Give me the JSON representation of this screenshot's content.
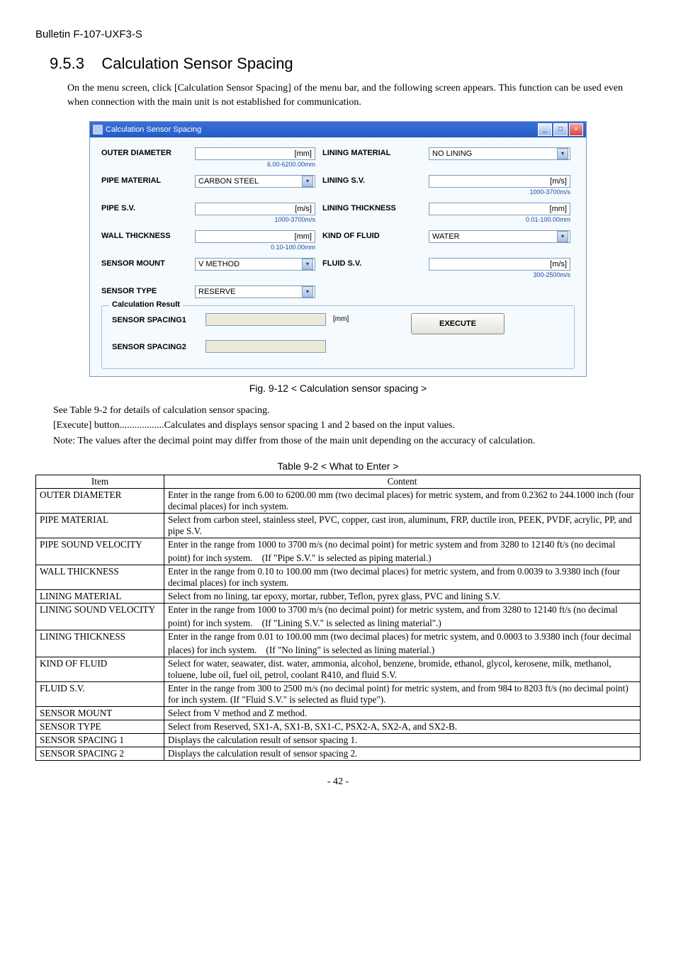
{
  "doc_header": "Bulletin F-107-UXF3-S",
  "section_number": "9.5.3",
  "section_title": "Calculation Sensor Spacing",
  "intro": "On the menu screen, click [Calculation Sensor Spacing] of the menu bar, and the following screen appears. This function can be used even when connection with the main unit is not established for communication.",
  "window": {
    "title": "Calculation Sensor Spacing",
    "rows": [
      {
        "label_l": "OUTER DIAMETER",
        "field_l": {
          "type": "input",
          "unit": "[mm]",
          "range": "6.00-6200.00mm"
        },
        "label_r": "LINING MATERIAL",
        "field_r": {
          "type": "dropdown",
          "value": "NO LINING"
        }
      },
      {
        "label_l": "PIPE MATERIAL",
        "field_l": {
          "type": "dropdown",
          "value": "CARBON STEEL"
        },
        "label_r": "LINING S.V.",
        "field_r": {
          "type": "input",
          "unit": "[m/s]",
          "range": "1000-3700m/s"
        }
      },
      {
        "label_l": "PIPE S.V.",
        "field_l": {
          "type": "input",
          "unit": "[m/s]",
          "range": "1000-3700m/s"
        },
        "label_r": "LINING THICKNESS",
        "field_r": {
          "type": "input",
          "unit": "[mm]",
          "range": "0.01-100.00mm"
        }
      },
      {
        "label_l": "WALL THICKNESS",
        "field_l": {
          "type": "input",
          "unit": "[mm]",
          "range": "0.10-100.00mm"
        },
        "label_r": "KIND OF FLUID",
        "field_r": {
          "type": "dropdown",
          "value": "WATER"
        }
      },
      {
        "label_l": "SENSOR MOUNT",
        "field_l": {
          "type": "dropdown",
          "value": "V METHOD"
        },
        "label_r": "FLUID S.V.",
        "field_r": {
          "type": "input",
          "unit": "[m/s]",
          "range": "300-2500m/s"
        }
      },
      {
        "label_l": "SENSOR TYPE",
        "field_l": {
          "type": "dropdown",
          "value": "RESERVE"
        },
        "label_r": "",
        "field_r": null
      }
    ],
    "result_group_title": "Calculation Result",
    "result1_label": "SENSOR SPACING1",
    "result2_label": "SENSOR SPACING2",
    "result_unit": "[mm]",
    "execute": "EXECUTE"
  },
  "fig_caption": "Fig. 9-12 < Calculation sensor spacing >",
  "see_table": "See Table 9-2 for details of calculation sensor spacing.",
  "execute_line": "[Execute] button..................Calculates and displays sensor spacing 1 and 2 based on the input values.",
  "note_line": "Note: The values after the decimal point may differ from those of the main unit depending on the accuracy of calculation.",
  "table_caption": "Table 9-2 < What to Enter >",
  "table_headers": {
    "item": "Item",
    "content": "Content"
  },
  "table_rows": [
    {
      "item": "OUTER DIAMETER",
      "content": "Enter in the range from 6.00 to 6200.00 mm (two decimal places) for metric system, and from 0.2362 to 244.1000 inch (four decimal places) for inch system."
    },
    {
      "item": "PIPE MATERIAL",
      "content": "Select from carbon steel, stainless steel, PVC, copper, cast iron, aluminum, FRP, ductile iron, PEEK, PVDF, acrylic, PP, and pipe S.V."
    },
    {
      "item": "PIPE SOUND VELOCITY",
      "content": "Enter in the range from 1000 to 3700 m/s (no decimal point) for metric system and from 3280 to 12140 ft/s (no decimal point) for inch system.　(If \"Pipe S.V.\" is selected as piping material.)"
    },
    {
      "item": "WALL THICKNESS",
      "content": "Enter in the range from 0.10 to 100.00 mm (two decimal places) for metric system, and from 0.0039 to 3.9380 inch (four decimal places) for inch system."
    },
    {
      "item": "LINING MATERIAL",
      "content": "Select from no lining, tar epoxy, mortar, rubber, Teflon, pyrex glass, PVC and lining S.V."
    },
    {
      "item": "LINING SOUND VELOCITY",
      "content": "Enter in the range from 1000 to 3700 m/s (no decimal point) for metric system, and from 3280 to 12140 ft/s (no decimal point) for inch system.　(If \"Lining S.V.\" is selected as lining material\".)"
    },
    {
      "item": "LINING THICKNESS",
      "content": "Enter in the range from 0.01 to 100.00 mm (two decimal places) for metric system, and 0.0003 to 3.9380 inch (four decimal places) for inch system.　(If \"No lining\" is selected as lining material.)"
    },
    {
      "item": "KIND OF FLUID",
      "content": "Select for water, seawater, dist. water, ammonia, alcohol, benzene, bromide, ethanol, glycol, kerosene, milk, methanol, toluene, lube oil, fuel oil, petrol, coolant R410, and fluid S.V."
    },
    {
      "item": "FLUID S.V.",
      "content": "Enter in the range from 300 to 2500 m/s (no decimal point) for metric system, and from 984 to 8203 ft/s (no decimal point) for inch system. (If \"Fluid S.V.\" is selected as fluid type\")."
    },
    {
      "item": "SENSOR MOUNT",
      "content": "Select from V method and Z method."
    },
    {
      "item": "SENSOR TYPE",
      "content": "Select from Reserved, SX1-A, SX1-B, SX1-C, PSX2-A, SX2-A, and SX2-B."
    },
    {
      "item": "SENSOR SPACING 1",
      "content": "Displays the calculation result of sensor spacing 1."
    },
    {
      "item": "SENSOR SPACING 2",
      "content": "Displays the calculation result of sensor spacing 2."
    }
  ],
  "page_number": "- 42 -"
}
